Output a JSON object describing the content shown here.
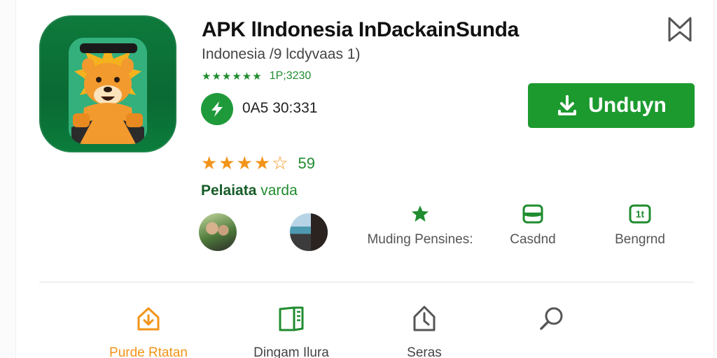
{
  "app": {
    "title": "APK lIndonesia InDackainSunda",
    "subtitle": "Indonesia /9 lcdyvaas 1)",
    "stars_small": "★★★★★★",
    "rating_count": "1P;3230",
    "bolt_text": "0A5 30:331",
    "download_label": "Unduyn",
    "stars_big": "★★★★☆",
    "rating_value": "59",
    "section_label_a": "Pelaiata",
    "section_label_b": " varda"
  },
  "features": [
    {
      "label": "Muding Pensines:",
      "icon": "star-icon"
    },
    {
      "label": "Casdnd",
      "icon": "shield-icon"
    },
    {
      "label": "Bengrnd",
      "icon": "number-badge-icon",
      "badge_text": "1t"
    }
  ],
  "nav": [
    {
      "label": "Purde Rtatan",
      "icon": "home-download-icon",
      "active": true
    },
    {
      "label": "Dingam Ilura",
      "icon": "book-icon"
    },
    {
      "label": "Seras",
      "icon": "compass-icon"
    },
    {
      "label": "",
      "icon": "search-icon"
    }
  ],
  "colors": {
    "accent_green": "#1c9a2e",
    "dark_green": "#0e7a3c",
    "star_orange": "#f29418"
  }
}
